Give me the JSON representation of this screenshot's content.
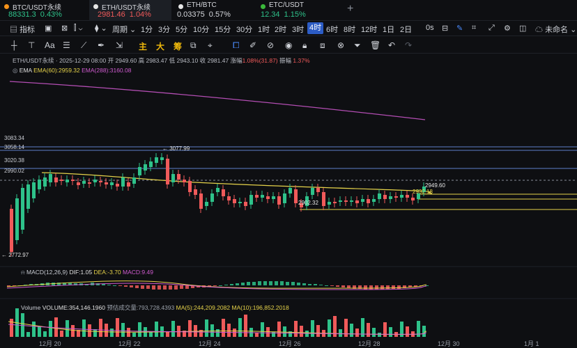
{
  "tabs": [
    {
      "name": "BTC/USDT永续",
      "price": "88331.3",
      "change": "0.43%",
      "dir": "up"
    },
    {
      "name": "ETH/USDT永续",
      "price": "2981.46",
      "change": "1.04%",
      "dir": "down",
      "active": true
    },
    {
      "name": "ETH/BTC",
      "price": "0.03375",
      "change": "0.57%",
      "dir": "flat"
    },
    {
      "name": "ETC/USDT",
      "price": "12.34",
      "change": "1.15%",
      "dir": "up"
    }
  ],
  "tab_add": "+",
  "toolbar": {
    "indicator": "指标",
    "period": "周期",
    "intervals": [
      "1分",
      "3分",
      "5分",
      "10分",
      "15分",
      "30分",
      "1时",
      "2时",
      "3时",
      "4时",
      "6时",
      "8时",
      "12时",
      "1日",
      "2日"
    ],
    "selected_interval": "4时",
    "countdown": "0s",
    "save_name": "未命名"
  },
  "drawing_tools": {
    "zhu": "主",
    "da": "大",
    "chou": "筹",
    "text": "Aa"
  },
  "info": {
    "symbol": "ETH/USDT永续",
    "time": "2025-12-29 08:00",
    "open_label": "开",
    "open": "2949.60",
    "high_label": "高",
    "high": "2983.47",
    "low_label": "低",
    "low": "2943.10",
    "close_label": "收",
    "close": "2981.47",
    "chg_label": "涨幅",
    "chg": "1.08%(31.87)",
    "amp_label": "振幅",
    "amp": "1.37%"
  },
  "ema": {
    "label": "EMA",
    "ema60": "EMA(60):2959.32",
    "ema288": "EMA(288):3160.08",
    "ema60_color": "#e6d34a",
    "ema288_color": "#d05bd0"
  },
  "price_labels": {
    "p3083": "3083.34",
    "p3058": "3058.14",
    "p3020": "3020.38",
    "p2990": "2990.02",
    "high_mark": "← 3077.99",
    "low_mark": "← 2772.97",
    "p2949": "2949.60",
    "p2932": "2932.18",
    "p2902": "2902.32"
  },
  "macd": {
    "label": "MACD(12,26,9)",
    "dif": "DIF:1.05",
    "dea": "DEA:-3.70",
    "macd": "MACD:9.49"
  },
  "volume": {
    "label": "Volume",
    "volume": "VOLUME:354,146.1960",
    "est": "预估成交量:793,728.4393",
    "ma5": "MA(5):244,209.2082",
    "ma10": "MA(10):196,852.2018"
  },
  "xaxis": [
    "12月 20",
    "12月 22",
    "12月 24",
    "12月 26",
    "12月 28",
    "12月 30",
    "1月 1"
  ],
  "colors": {
    "up": "#2ec28a",
    "down": "#f05a5a",
    "bg": "#0e0f12",
    "accent": "#2c5cc5"
  }
}
